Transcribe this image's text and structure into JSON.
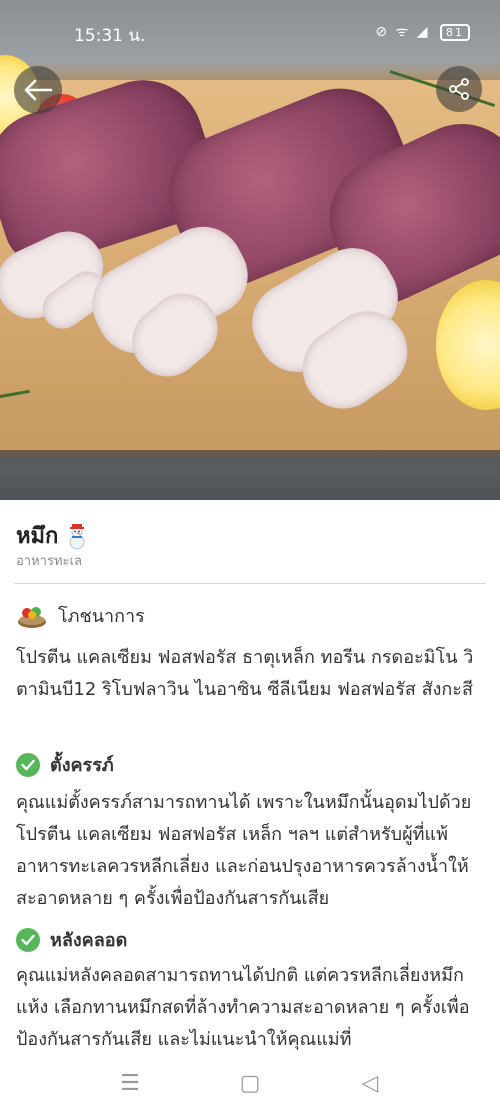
{
  "status_bar": {
    "time": "15:31 น.",
    "icons": "⊘ ᯤ ◢",
    "battery": "81"
  },
  "hero": {
    "back_icon": "back-arrow-icon",
    "share_icon": "share-icon"
  },
  "food": {
    "title": "หมึก",
    "category": "อาหารทะเล"
  },
  "nutrition": {
    "heading": "โภชนาการ",
    "text": "โปรตีน แคลเซียม ฟอสฟอรัส ธาตุเหล็ก ทอรีน กรดอะมิโน วิตามินบี12 ริโบฟลาวิน ไนอาซิน ซีลีเนียม ฟอสฟอรัส สังกะสี"
  },
  "pregnant": {
    "heading": "ตั้งครรภ์",
    "text": "คุณแม่ตั้งครรภ์สามารถทานได้ เพราะในหมึกนั้นอุดมไปด้วยโปรตีน แคลเซียม ฟอสฟอรัส เหล็ก ฯลฯ แต่สำหรับผู้ที่แพ้อาหารทะเลควรหลีกเลี่ยง และก่อนปรุงอาหารควรล้างน้ำให้สะอาดหลาย ๆ ครั้งเพื่อป้องกันสารกันเสีย"
  },
  "postpartum": {
    "heading": "หลังคลอด",
    "text": "คุณแม่หลังคลอดสามารถทานได้ปกติ แต่ควรหลีกเลี่ยงหมึกแห้ง เลือกทานหมึกสดที่ล้างทำความสะอาดหลาย ๆ ครั้งเพื่อป้องกันสารกันเสีย และไม่แนะนำให้คุณแม่ที่"
  },
  "nav": {
    "recent": "☰",
    "home": "▢",
    "back": "◁"
  },
  "colors": {
    "check_green": "#58b65a",
    "subtitle_gray": "#8a8a8a"
  }
}
